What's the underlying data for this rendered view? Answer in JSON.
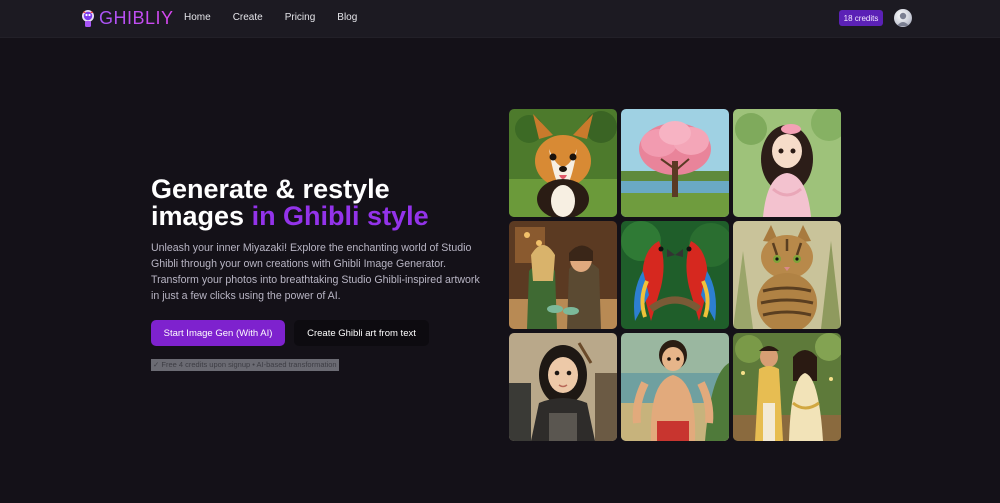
{
  "brand": {
    "name": "GHIBLIY"
  },
  "nav": {
    "items": [
      "Home",
      "Create",
      "Pricing",
      "Blog"
    ]
  },
  "account": {
    "credits_label": "18 credits"
  },
  "hero": {
    "title_line1": "Generate & restyle",
    "title_line2_plain": "images ",
    "title_line2_accent": "in Ghibli style",
    "description": "Unleash your inner Miyazaki! Explore the enchanting world of Studio Ghibli through your own creations with Ghibli Image Generator. Transform your photos into breathtaking Studio Ghibli-inspired artwork in just a few clicks using the power of AI.",
    "primary_cta": "Start Image Gen (With AI)",
    "secondary_cta": "Create Ghibli art from text",
    "footnote": "✓ Free 4 credits upon signup • AI-based transformation"
  },
  "gallery": {
    "tiles": [
      "corgi-illustration",
      "cherry-tree-illustration",
      "girl-in-pink-illustration",
      "couple-cafe-illustration",
      "parrots-illustration",
      "tabby-cat-illustration",
      "archer-woman-illustration",
      "boy-by-sea-illustration",
      "wedding-couple-illustration"
    ]
  },
  "colors": {
    "accent": "#9333ea",
    "primary_button": "#7e22ce",
    "background": "#141118",
    "navbar": "#1c1a22",
    "credits_badge": "#5b21b6"
  }
}
